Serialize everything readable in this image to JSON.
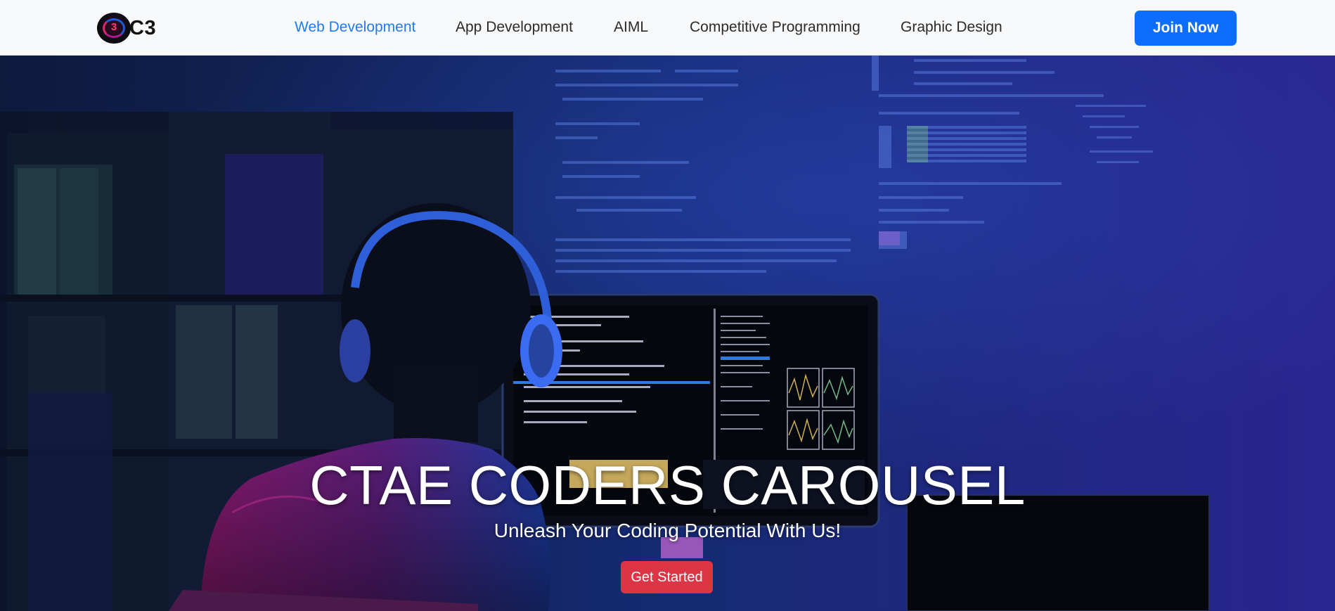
{
  "brand": {
    "text": "C3",
    "logo_icon": "c3-logo-icon",
    "logo_number": "3"
  },
  "nav": {
    "items": [
      {
        "label": "Web Development",
        "active": true
      },
      {
        "label": "App Development",
        "active": false
      },
      {
        "label": "AIML",
        "active": false
      },
      {
        "label": "Competitive Programming",
        "active": false
      },
      {
        "label": "Graphic Design",
        "active": false
      }
    ],
    "join_label": "Join Now"
  },
  "hero": {
    "title": "CTAE CODERS CAROUSEL",
    "subtitle": "Unleash Your Coding Potential With Us!",
    "cta_label": "Get Started",
    "background_image": "programmer-with-headphones-at-computer"
  },
  "colors": {
    "accent": "#0d6efd",
    "active_link": "#1f7cf0",
    "cta": "#dc3545",
    "navbar_bg": "#f8f9fa"
  }
}
